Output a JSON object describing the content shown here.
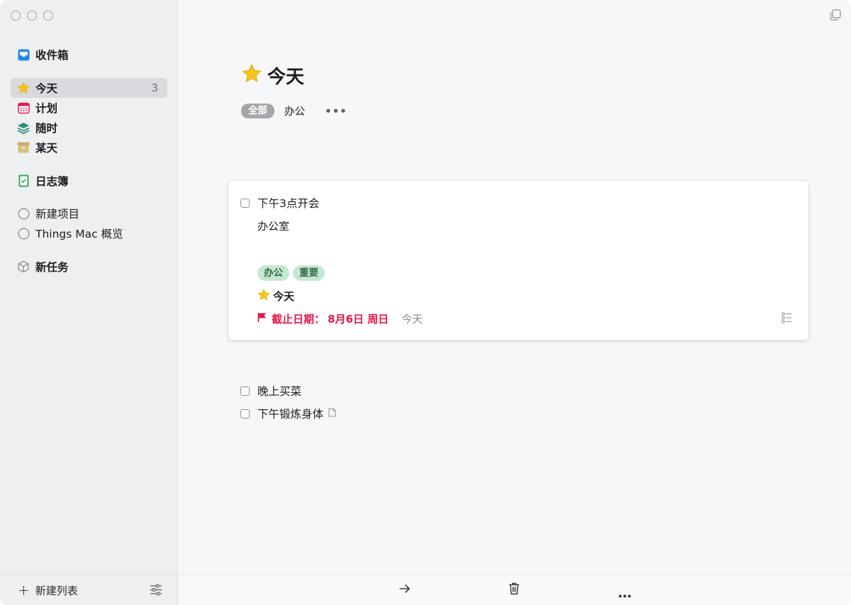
{
  "sidebar": {
    "inbox": {
      "label": "收件箱",
      "icon": "inbox-icon"
    },
    "today": {
      "label": "今天",
      "count": "3",
      "icon": "star-icon"
    },
    "upcoming": {
      "label": "计划",
      "icon": "calendar-icon"
    },
    "anytime": {
      "label": "随时",
      "icon": "layers-icon"
    },
    "someday": {
      "label": "某天",
      "icon": "archive-box-icon"
    },
    "logbook": {
      "label": "日志簿",
      "icon": "logbook-icon"
    },
    "projects": [
      {
        "label": "新建项目",
        "icon": "progress-circle-icon"
      },
      {
        "label": "Things Mac 概览",
        "icon": "progress-circle-icon"
      }
    ],
    "area": {
      "label": "新任务",
      "icon": "cube-icon"
    },
    "footer": {
      "new_list_label": "新建列表",
      "plus_icon": "plus-icon",
      "settings_icon": "sliders-icon"
    }
  },
  "main": {
    "title": "今天",
    "filters": {
      "all": "全部",
      "tag": "办公",
      "more": "•••"
    },
    "expanded_task": {
      "title": "下午3点开会",
      "notes": "办公室",
      "tags": [
        "办公",
        "重要"
      ],
      "when": "今天",
      "deadline_label": "截止日期：",
      "deadline_date": "8月6日 周日",
      "deadline_relative": "今天"
    },
    "tasks": [
      {
        "title": "晚上买菜",
        "has_note": false
      },
      {
        "title": "下午锻炼身体",
        "has_note": true
      }
    ],
    "bottom_bar": {
      "move_icon": "arrow-right-icon",
      "delete_icon": "trash-icon",
      "more_icon": "ellipsis-icon"
    }
  },
  "colors": {
    "accent_red": "#e3174a",
    "star_yellow": "#f7c41c",
    "tag_green_bg": "#c6e7d3",
    "tag_green_text": "#2e6b45",
    "inbox_blue": "#1e8ae8"
  }
}
